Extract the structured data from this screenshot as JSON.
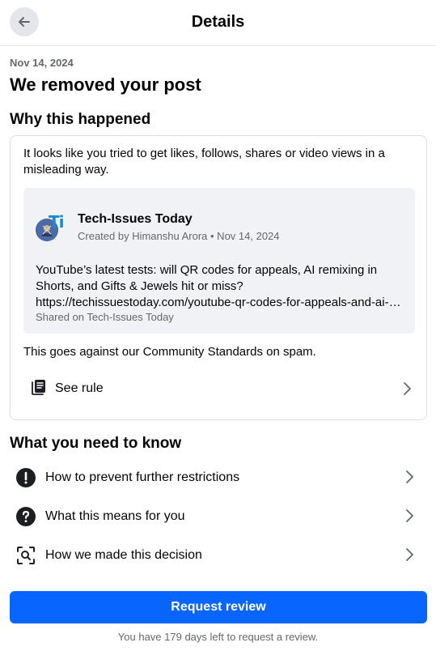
{
  "header": {
    "title": "Details"
  },
  "date": "Nov 14, 2024",
  "title": "We removed your post",
  "why": {
    "heading": "Why this happened",
    "description": "It looks like you tried to get likes, follows, shares or video views in a misleading way.",
    "post": {
      "page_name": "Tech-Issues Today",
      "badge": "Ti",
      "meta": "Created by Himanshu Arora • Nov 14, 2024",
      "body_lines": [
        "YouTube’s latest tests: will QR codes for appeals, AI remixing in",
        "Shorts, and Gifts & Jewels hit or miss?",
        "https://techissuestoday.com/youtube-qr-codes-for-appeals-and-ai-remixing-in-shorts/"
      ],
      "shared_on": "Shared on Tech-Issues Today"
    },
    "standards_text": "This goes against our Community Standards on spam.",
    "see_rule_label": "See rule"
  },
  "know": {
    "heading": "What you need to know",
    "items": [
      {
        "label": "How to prevent further restrictions",
        "icon": "exclamation-icon"
      },
      {
        "label": "What this means for you",
        "icon": "question-icon"
      },
      {
        "label": "How we made this decision",
        "icon": "search-frame-icon"
      }
    ]
  },
  "review": {
    "button_label": "Request review",
    "footnote": "You have 179 days left to request a review."
  },
  "colors": {
    "accent": "#0866ff",
    "secondary_text": "#65676b",
    "divider": "#dadde1"
  }
}
